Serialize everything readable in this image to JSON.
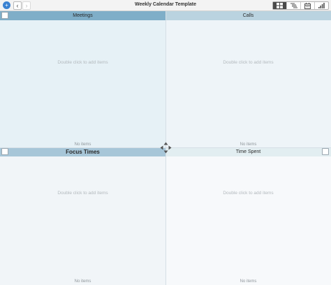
{
  "toolbar": {
    "title": "Weekly Calendar Template",
    "menu_glyph": "+",
    "back_glyph": "‹",
    "forward_glyph": "›",
    "views": [
      "grid-view-icon",
      "outline-view-icon",
      "calendar-view-icon",
      "chart-view-icon"
    ],
    "active_view": "grid-view-icon"
  },
  "quadrants": [
    {
      "title": "Meetings",
      "hint": "Double click to add items",
      "empty_text": "No items",
      "color": "#7faec8"
    },
    {
      "title": "Calls",
      "hint": "Double click to add items",
      "empty_text": "No items",
      "color": "#bad3e0"
    },
    {
      "title": "Focus Times",
      "hint": "Double click to add items",
      "empty_text": "No items",
      "color": "#a7c6d8"
    },
    {
      "title": "Time Spent",
      "hint": "Double click to add items",
      "empty_text": "No items",
      "color": "#e2eef1"
    }
  ]
}
